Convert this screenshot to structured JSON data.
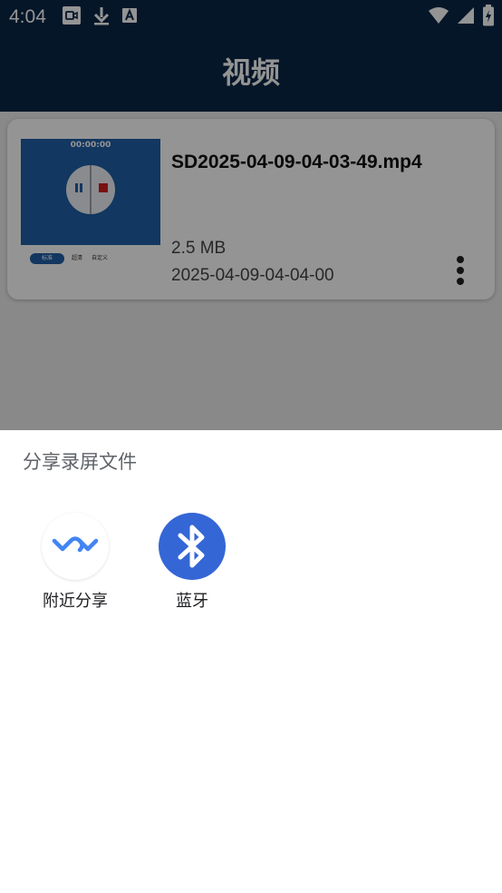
{
  "status_bar": {
    "time": "4:04",
    "left_icons": [
      "video-camera-icon",
      "download-icon",
      "text-a-icon"
    ],
    "right_icons": [
      "wifi-icon",
      "cellular-signal-icon",
      "battery-charging-icon"
    ]
  },
  "app_bar": {
    "title": "视频"
  },
  "video_list": [
    {
      "thumbnail": {
        "timer": "00:00:00",
        "controls": [
          "pause-icon",
          "stop-icon"
        ],
        "segments": [
          "标准",
          "超清",
          "自定义"
        ]
      },
      "name": "SD2025-04-09-04-03-49.mp4",
      "size": "2.5 MB",
      "date": "2025-04-09-04-04-00",
      "more_icon": "more-vert-icon"
    }
  ],
  "share_sheet": {
    "title": "分享录屏文件",
    "options": [
      {
        "label": "附近分享",
        "icon": "nearby-share-icon"
      },
      {
        "label": "蓝牙",
        "icon": "bluetooth-icon"
      }
    ]
  },
  "colors": {
    "app_bar": "#0a2746",
    "scrim": "rgba(0,0,0,0.42)",
    "bluetooth_blue": "#3566d6",
    "nearby_blue": "#4285f4",
    "thumbnail_blue": "#1f5fa6",
    "stop_red": "#d21e1e"
  }
}
